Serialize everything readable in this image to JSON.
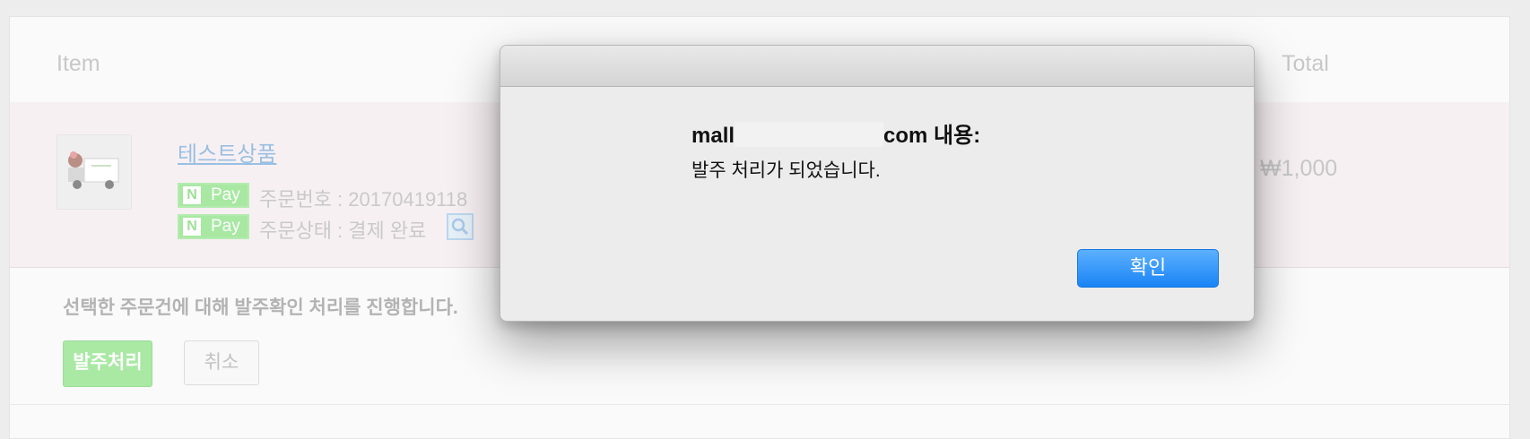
{
  "table": {
    "header_item": "Item",
    "header_total": "Total"
  },
  "order": {
    "product_name": "테스트상품",
    "pay_badge": "Pay",
    "pay_badge_icon": "naver-n-icon",
    "order_number_text": "주문번호 : 20170419118",
    "order_status_text": "주문상태 : 결제 완료",
    "price": "₩1,000"
  },
  "actions": {
    "notice": "선택한 주문건에 대해 발주확인 처리를 진행합니다.",
    "process_label": "발주처리",
    "cancel_label": "취소"
  },
  "dialog": {
    "title_prefix": "mall",
    "title_suffix": "com 내용:",
    "message": "발주 처리가 되었습니다.",
    "ok_label": "확인"
  },
  "colors": {
    "accent_blue": "#1a84f5",
    "npay_green": "#a8e8a3"
  }
}
